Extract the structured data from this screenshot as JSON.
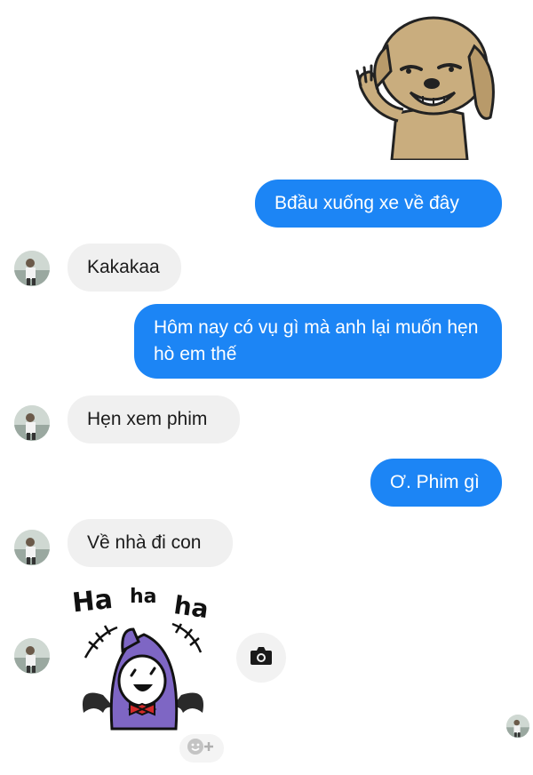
{
  "messages": {
    "m1": "Bđầu xuống xe về đây",
    "m2": "Kakakaa",
    "m3": "Hôm nay có vụ gì mà anh lại muốn hẹn hò em thế",
    "m4": "Hẹn xem phim",
    "m5": "Ơ. Phim gì",
    "m6": "Về nhà đi con"
  },
  "stickers": {
    "dog": {
      "icon": "dog-sticker"
    },
    "haha": {
      "icon": "laughing-ghost-sticker",
      "text": "Ha ha ha"
    }
  },
  "icons": {
    "camera": "camera-icon",
    "emoji_reaction": "add-reaction-icon"
  },
  "colors": {
    "outgoing_bubble": "#1c85f5",
    "incoming_bubble": "#f0f0f0"
  }
}
